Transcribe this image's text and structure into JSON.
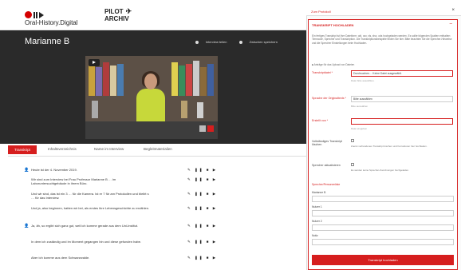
{
  "brand": {
    "line1": "Oral-History.Digital",
    "pilot_line1": "PILOT",
    "pilot_line2": "ARCHIV"
  },
  "hero": {
    "title": "Marianne B",
    "actions": [
      "Interview teilen",
      "Zwischen speichern"
    ]
  },
  "tabs": [
    "Transkript",
    "Inhaltsverzeichnis",
    "Name im Interview",
    "Begleitmaterialien"
  ],
  "transcript": [
    {
      "speaker": "interviewer",
      "text": "Heute ist der 4. November 2019.",
      "actions": "✎ ❚❚ ■ ▶"
    },
    {
      "speaker": "",
      "text": "Wir sind zum Interview bei Frau Professor Marianne B … im Laboruntersuchtgebäude in ihrem Büro.",
      "actions": "✎ ❚❚ ■ ▶"
    },
    {
      "speaker": "",
      "text": "Und wir sind, das ist ein 3 … für die Kamera. Ist er 7 für am Protokollen und bleibt s … für das Interview.",
      "actions": "✎ ❚❚ ■ ▶"
    },
    {
      "speaker": "",
      "text": "Und ja, also beginnen, hatten wir bei, als erstes ihre Lebensgeschichte zu erzählen.",
      "actions": "✎ ❚❚ ■ ▶"
    },
    {
      "speaker": "interviewee",
      "text": "Ja, äh, so ergibt sich ganz gut, weil ich komme gerade aus dem Uni-Institut.",
      "actions": "✎ ❚❚ ■ ▶"
    },
    {
      "speaker": "",
      "text": "In dem ich zuständig und im Moment gegangen bin und diese gefunden habe.",
      "actions": "✎ ❚❚ ■ ▶"
    },
    {
      "speaker": "",
      "text": "Aber ich komme aus dem Schwarzwalde.",
      "actions": "✎ ❚❚ ■ ▶"
    }
  ],
  "panel": {
    "header_label": "Zum Protokoll",
    "close_icon": "×",
    "form_title": "TRANSKRIPT HOCHLADEN",
    "collapse": "–",
    "intro": "Ein fertiges Transkript ist Ihre Dateiform: odt, csv, xls, xlsx, ods hochgeladen werden. Es sollte folgenden Spalten enthalten: Timecode, Sprecher und Transkription. Die Transkriptionsbeispiele finden Sie hier. Bitte beachten Sie die Sprecher-Hinweise und die Sprecher Einstellungen beim Hochladen.",
    "required_note": "■ Anträge für das Upload von Dateien",
    "fields": {
      "transcript_label": "Transkriptdatei *",
      "transcript_value": "Durchsuchen… Keine Datei ausgewählt.",
      "transcript_help": "Datei bitte auswählen.",
      "language_label": "Sprache der Originaltexts *",
      "language_value": "Bitte auswählen",
      "language_help": "Bitte auswählen",
      "contributor_label": "Erstellt von *",
      "contributor_help": "Datei eingeben",
      "checkbox1_label": "Vollständiges Transkript löschen",
      "checkbox1_note": "Zuerst vorhandenes Transkript löschen und Korrekturen hier hochladen.",
      "checkbox2_label": "Sprecher aktualisieren",
      "checkbox2_note": "Es werden keine Sprecher-Zuordnungen hochgeladen."
    },
    "speaker_section": "Sprecher/Personenliste",
    "speakers": [
      "Marianne B",
      "Nutzer 1",
      "Nutzer 2",
      "Notiz"
    ],
    "submit": "Transkript hochladen"
  }
}
